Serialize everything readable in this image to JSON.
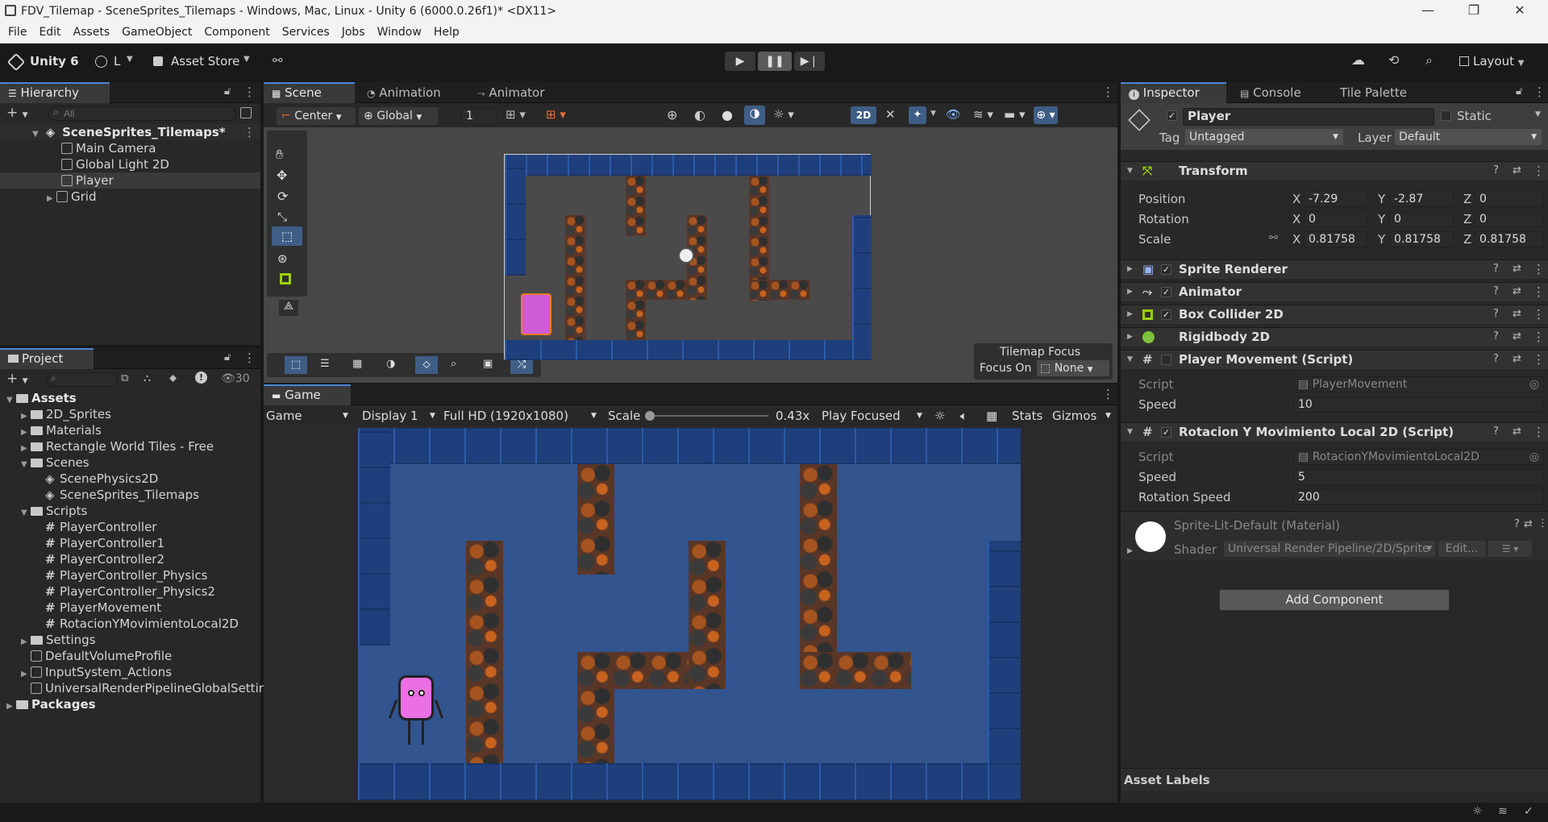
{
  "window": {
    "title": "FDV_Tilemap - SceneSprites_Tilemaps - Windows, Mac, Linux - Unity 6 (6000.0.26f1)* <DX11>"
  },
  "menu": [
    "File",
    "Edit",
    "Assets",
    "GameObject",
    "Component",
    "Services",
    "Jobs",
    "Window",
    "Help"
  ],
  "toolbar": {
    "unity_label": "Unity 6",
    "account_label": "L",
    "asset_store_label": "Asset Store",
    "layout_label": "Layout"
  },
  "hierarchy": {
    "tab": "Hierarchy",
    "search_placeholder": "All",
    "scene_name": "SceneSprites_Tilemaps*",
    "items": [
      "Main Camera",
      "Global Light 2D",
      "Player",
      "Grid"
    ]
  },
  "project": {
    "tab": "Project",
    "hidden_count": "30",
    "items": [
      {
        "label": "Assets",
        "type": "folder",
        "bold": true
      },
      {
        "label": "2D_Sprites",
        "type": "folder"
      },
      {
        "label": "Materials",
        "type": "folder"
      },
      {
        "label": "Rectangle World Tiles - Free",
        "type": "folder"
      },
      {
        "label": "Scenes",
        "type": "folder"
      },
      {
        "label": "ScenePhysics2D",
        "type": "scene"
      },
      {
        "label": "SceneSprites_Tilemaps",
        "type": "scene"
      },
      {
        "label": "Scripts",
        "type": "folder"
      },
      {
        "label": "PlayerController",
        "type": "script"
      },
      {
        "label": "PlayerController1",
        "type": "script"
      },
      {
        "label": "PlayerController2",
        "type": "script"
      },
      {
        "label": "PlayerController_Physics",
        "type": "script"
      },
      {
        "label": "PlayerController_Physics2",
        "type": "script"
      },
      {
        "label": "PlayerMovement",
        "type": "script"
      },
      {
        "label": "RotacionYMovimientoLocal2D",
        "type": "script"
      },
      {
        "label": "Settings",
        "type": "folder"
      },
      {
        "label": "DefaultVolumeProfile",
        "type": "asset"
      },
      {
        "label": "InputSystem_Actions",
        "type": "asset"
      },
      {
        "label": "UniversalRenderPipelineGlobalSettings",
        "type": "asset"
      },
      {
        "label": "Packages",
        "type": "folder",
        "bold": true
      }
    ]
  },
  "scene_view": {
    "tabs": [
      "Scene",
      "Animation",
      "Animator"
    ],
    "pivot": "Center",
    "space": "Global",
    "grid_value": "1",
    "mode_2d": "2D",
    "tilemap_focus_title": "Tilemap Focus",
    "focus_on_label": "Focus On",
    "focus_value": "None"
  },
  "game_view": {
    "tab": "Game",
    "mode": "Game",
    "display": "Display 1",
    "resolution": "Full HD (1920x1080)",
    "scale_label": "Scale",
    "scale_value": "0.43x",
    "play_mode": "Play Focused",
    "stats": "Stats",
    "gizmos": "Gizmos"
  },
  "inspector": {
    "tabs": [
      "Inspector",
      "Console",
      "Tile Palette"
    ],
    "object_name": "Player",
    "static_label": "Static",
    "tag_label": "Tag",
    "tag_value": "Untagged",
    "layer_label": "Layer",
    "layer_value": "Default",
    "transform": {
      "title": "Transform",
      "position_label": "Position",
      "rotation_label": "Rotation",
      "scale_label": "Scale",
      "position": {
        "x": "-7.29",
        "y": "-2.87",
        "z": "0"
      },
      "rotation": {
        "x": "0",
        "y": "0",
        "z": "0"
      },
      "scale": {
        "x": "0.81758",
        "y": "0.81758",
        "z": "0.81758"
      }
    },
    "components": [
      "Sprite Renderer",
      "Animator",
      "Box Collider 2D",
      "Rigidbody 2D"
    ],
    "player_movement": {
      "title": "Player Movement (Script)",
      "script_label": "Script",
      "script_value": "PlayerMovement",
      "speed_label": "Speed",
      "speed_value": "10"
    },
    "rotacion": {
      "title": "Rotacion Y Movimiento Local 2D (Script)",
      "script_label": "Script",
      "script_value": "RotacionYMovimientoLocal2D",
      "speed_label": "Speed",
      "speed_value": "5",
      "rotation_speed_label": "Rotation Speed",
      "rotation_speed_value": "200"
    },
    "material": {
      "title": "Sprite-Lit-Default (Material)",
      "shader_label": "Shader",
      "shader_value": "Universal Render Pipeline/2D/Sprite",
      "edit_label": "Edit..."
    },
    "add_component": "Add Component",
    "asset_labels": "Asset Labels"
  },
  "colors": {
    "accent": "#4a86d6",
    "panel": "#282828",
    "background": "#191919"
  }
}
